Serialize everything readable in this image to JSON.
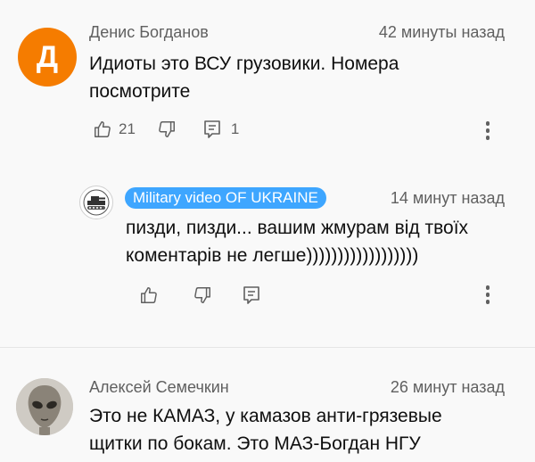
{
  "comments": [
    {
      "author": "Денис Богданов",
      "time": "42 минуты назад",
      "avatar_letter": "Д",
      "avatar_color": "#f57c00",
      "text_line1": "Идиоты это ВСУ грузовики. Номера",
      "text_line2": "посмотрите",
      "likes": "21",
      "replies": "1"
    },
    {
      "author": "Military video OF UKRAINE",
      "time": "14 минут назад",
      "author_badge_color": "#3ea6ff",
      "avatar_icon": "tank-logo-icon",
      "text_line1": "пизди, пизди... вашим жмурам від твоїх",
      "text_line2": "коментарів не легше))))))))))))))))))"
    },
    {
      "author": "Алексей Семечкин",
      "time": "26 минут назад",
      "avatar_icon": "alien-face-icon",
      "text_line1": "Это не КАМАЗ, у камазов анти-грязевые",
      "text_line2": "щитки по бокам. Это МАЗ-Богдан НГУ"
    }
  ]
}
